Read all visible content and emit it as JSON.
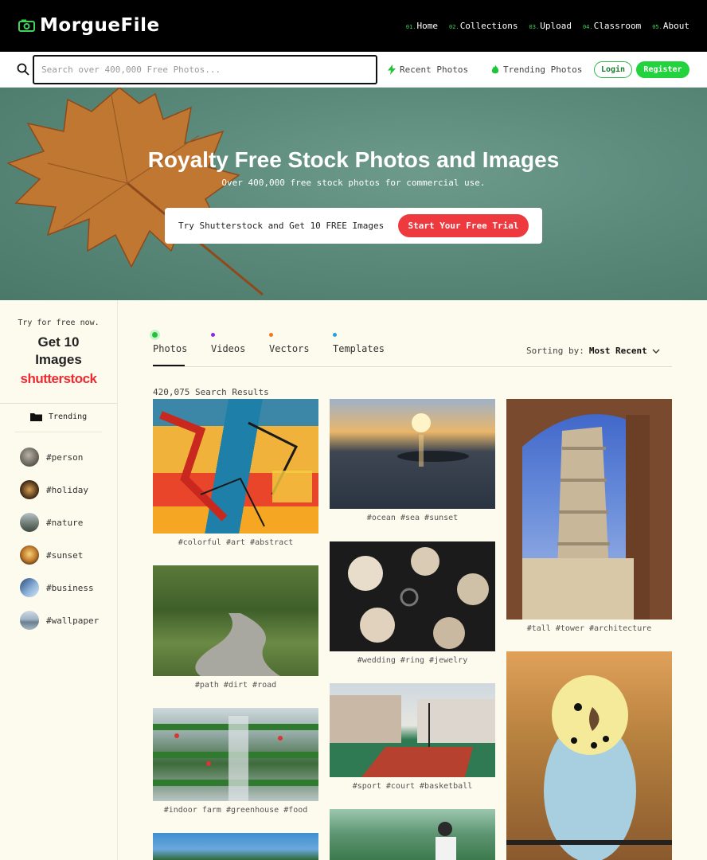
{
  "brand": {
    "name": "MorgueFile"
  },
  "nav": [
    {
      "num": "01.",
      "label": "Home"
    },
    {
      "num": "02.",
      "label": "Collections"
    },
    {
      "num": "03.",
      "label": "Upload"
    },
    {
      "num": "04.",
      "label": "Classroom"
    },
    {
      "num": "05.",
      "label": "About"
    }
  ],
  "search": {
    "placeholder": "Search over 400,000 Free Photos...",
    "value": ""
  },
  "links": {
    "recent": "Recent Photos",
    "trending": "Trending Photos",
    "login": "Login",
    "register": "Register"
  },
  "hero": {
    "title": "Royalty Free Stock Photos and Images",
    "subtitle": "Over 400,000 free stock photos for commercial use.",
    "cta_text": "Try Shutterstock and Get 10 FREE Images",
    "cta_button": "Start Your Free Trial"
  },
  "sidebar": {
    "promo_small": "Try for free now.",
    "promo_big": "Get 10 Images",
    "promo_brand": "shutterstock",
    "trending_label": "Trending",
    "tags": [
      "#person",
      "#holiday",
      "#nature",
      "#sunset",
      "#business",
      "#wallpaper"
    ]
  },
  "tabs": [
    {
      "label": "Photos",
      "color": "#22c33a"
    },
    {
      "label": "Videos",
      "color": "#8a2be2"
    },
    {
      "label": "Vectors",
      "color": "#f07a1a"
    },
    {
      "label": "Templates",
      "color": "#1ea7d6"
    }
  ],
  "sorting": {
    "label": "Sorting by:",
    "value": "Most Recent"
  },
  "results": "420,075 Search Results",
  "photos": {
    "p1": "#colorful #art #abstract",
    "p2": "#ocean #sea #sunset",
    "p3": "#tall #tower #architecture",
    "p4": "#path #dirt #road",
    "p5": "#wedding #ring #jewelry",
    "p6": "#indoor farm #greenhouse #food",
    "p7": "#sport #court #basketball"
  },
  "colors": {
    "accent_green": "#22d33d",
    "cta_red": "#ee3a3f",
    "background": "#fdfbed"
  }
}
